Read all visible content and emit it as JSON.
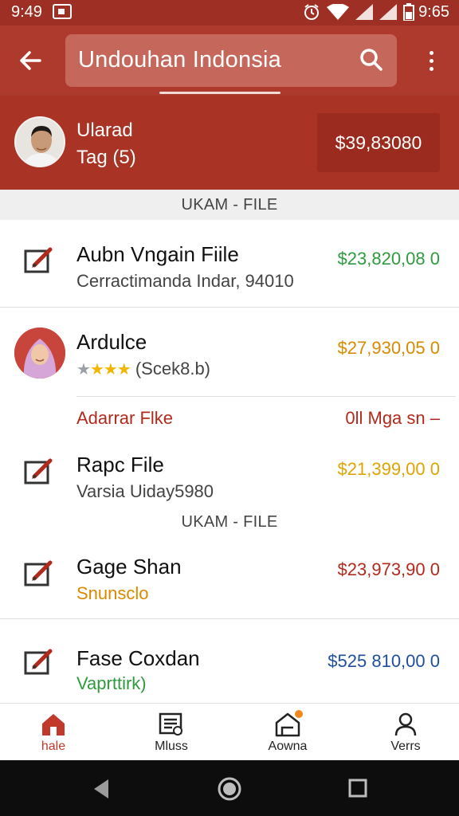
{
  "status_bar": {
    "time_left": "9:49",
    "time_right": "9:65"
  },
  "app_bar": {
    "search_text": "Undouhan Indonsia"
  },
  "profile": {
    "name": "Ularad",
    "subtitle": "Tag (5)",
    "balance": "$39,83080"
  },
  "section_header": "UKAM - FILE",
  "items": [
    {
      "title": "Aubn Vngain Fiile",
      "subtitle": "Cerractimanda Indar, 94010",
      "amount": "$23,820,08 0",
      "amount_color": "#2e9c3e"
    },
    {
      "title": "Ardulce",
      "rating_text": "(Scek8.b)",
      "stars": 4,
      "amount": "$27,930,05 0",
      "amount_color": "#d98a00"
    },
    {
      "title": "Adarrar Flke",
      "amount": "0ll Mga sn –",
      "color": "#b22a1c"
    },
    {
      "title": "Rapc File",
      "subtitle": "Varsia Uiday5980",
      "amount": "$21,399,00 0",
      "amount_color": "#e0a400"
    },
    {
      "title": "Gage Shan",
      "subtitle": "Snunsclo",
      "subtitle_color": "#d98a00",
      "amount": "$23,973,90 0",
      "amount_color": "#b22a1c"
    },
    {
      "title": "Fase Coxdan",
      "subtitle": "Vaprttirk)",
      "subtitle_color": "#2e9c3e",
      "amount": "$525 810,00 0",
      "amount_color": "#1f4f9c"
    }
  ],
  "section_header_2": "UKAM - FILE",
  "bottom_nav": [
    {
      "label": "hale",
      "icon": "home-icon",
      "active": true
    },
    {
      "label": "Mluss",
      "icon": "document-icon",
      "active": false
    },
    {
      "label": "Aowna",
      "icon": "house-badge-icon",
      "active": false
    },
    {
      "label": "Verrs",
      "icon": "person-icon",
      "active": false
    }
  ],
  "colors": {
    "primary": "#ad3a2c",
    "status_bar": "#9e2f24",
    "balance_bg": "#9b2b1f"
  }
}
